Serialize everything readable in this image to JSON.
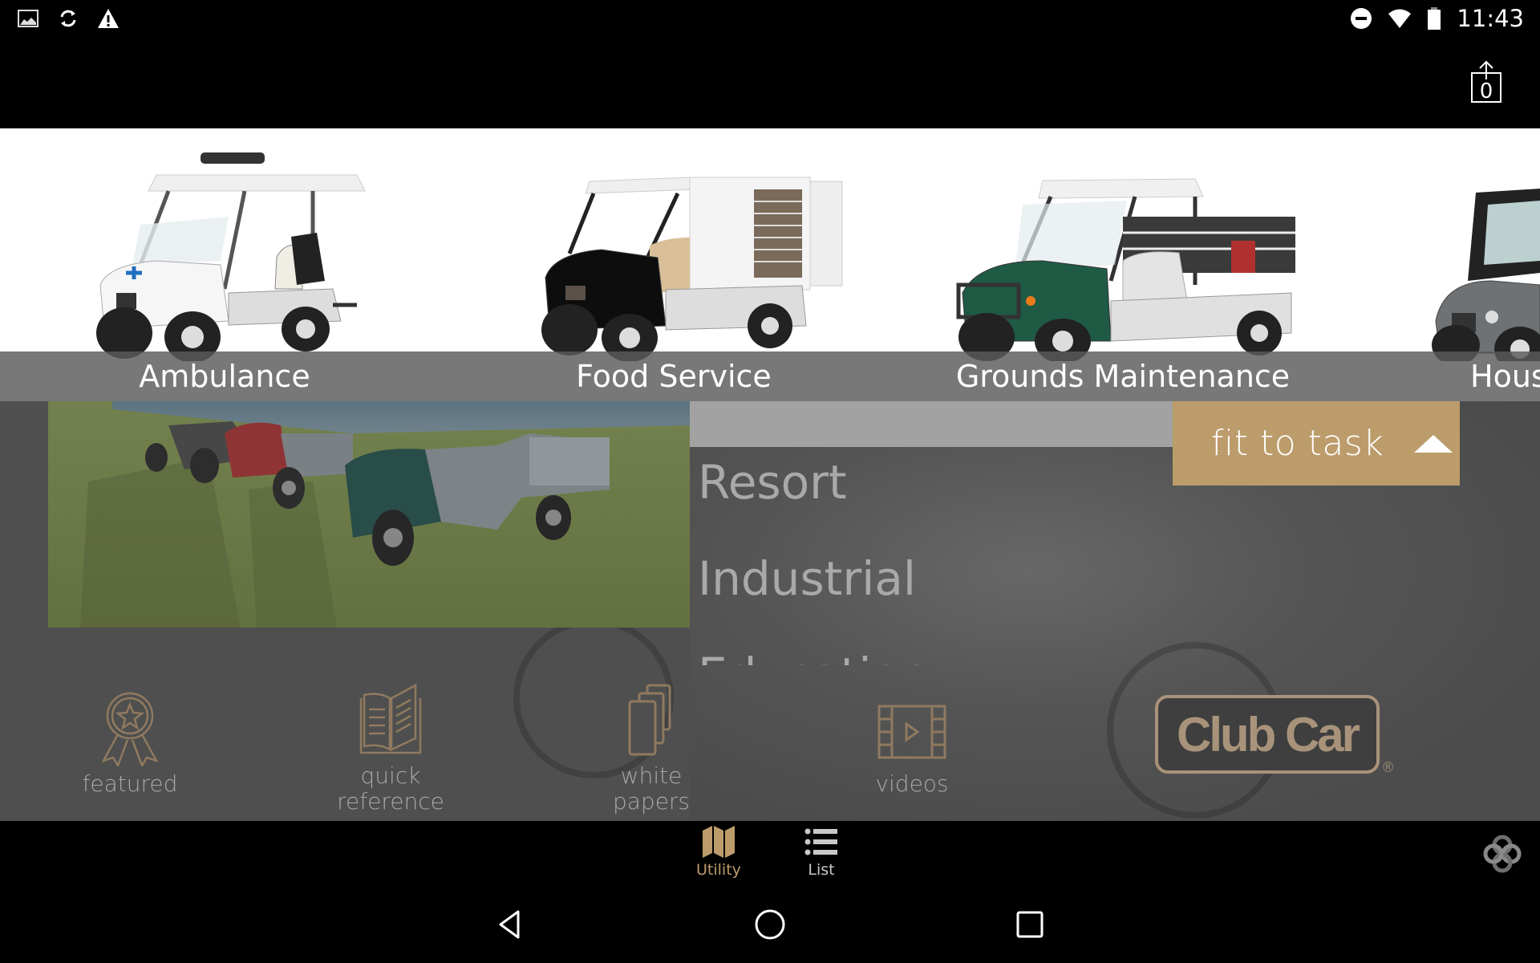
{
  "status_bar": {
    "left_icons": [
      "image-icon",
      "sync-icon",
      "warning-icon"
    ],
    "right_icons": [
      "do-not-disturb-icon",
      "wifi-icon",
      "battery-icon"
    ],
    "time": "11:43"
  },
  "action_bar": {
    "share_count": "0"
  },
  "carousel": {
    "items": [
      {
        "label": "Ambulance",
        "body_color": "#f2f2f2"
      },
      {
        "label": "Food Service",
        "body_color": "#111111"
      },
      {
        "label": "Grounds Maintenance",
        "body_color": "#1f5a45"
      },
      {
        "label": "Hous",
        "body_color": "#6f7275"
      }
    ]
  },
  "main": {
    "fit_to_task_label": "fit to task",
    "categories": [
      "Resort",
      "Industrial",
      "Education"
    ]
  },
  "features": [
    {
      "label": "featured",
      "icon": "award-ribbon-icon"
    },
    {
      "label": "quick\nreference",
      "line1": "quick",
      "line2": "reference",
      "icon": "open-book-icon"
    },
    {
      "label": "white\npapers",
      "line1": "white",
      "line2": "papers",
      "icon": "stacked-pages-icon"
    },
    {
      "label": "videos",
      "icon": "film-play-icon"
    }
  ],
  "brand": {
    "logo_text": "Club Car",
    "registered_mark": "®",
    "accent_color": "#bc9c6b"
  },
  "tabs": [
    {
      "label": "Utility",
      "icon": "map-icon",
      "active": true
    },
    {
      "label": "List",
      "icon": "list-icon",
      "active": false
    }
  ],
  "nav": [
    "back",
    "home",
    "recents"
  ]
}
